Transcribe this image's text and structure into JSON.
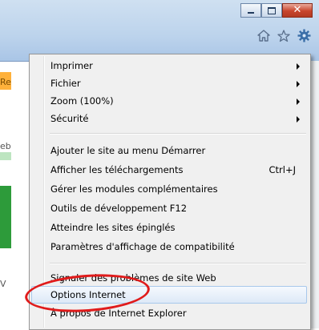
{
  "window": {
    "controls": [
      "minimize-icon",
      "maximize-icon",
      "close-icon"
    ],
    "toolbar_icons": [
      "home-icon",
      "favorites-star-icon",
      "tools-gear-icon"
    ]
  },
  "background_fragments": [
    "Re",
    "eb",
    "V"
  ],
  "menu": {
    "items": [
      {
        "label": "Imprimer",
        "submenu": true
      },
      {
        "label": "Fichier",
        "submenu": true
      },
      {
        "label": "Zoom (100%)",
        "submenu": true
      },
      {
        "label": "Sécurité",
        "submenu": true
      },
      {
        "label": "Ajouter le site au menu Démarrer"
      },
      {
        "label": "Afficher les téléchargements",
        "shortcut": "Ctrl+J"
      },
      {
        "label": "Gérer les modules complémentaires"
      },
      {
        "label": "Outils de développement F12"
      },
      {
        "label": "Atteindre les sites épinglés"
      },
      {
        "label": "Paramètres d'affichage de compatibilité"
      },
      {
        "label": "Signaler des problèmes de site Web"
      },
      {
        "label": "Options Internet",
        "highlighted": true
      },
      {
        "label": "À propos de Internet Explorer"
      }
    ]
  },
  "colors": {
    "annotation_circle": "#e01b1b",
    "highlight": "#dde9f7",
    "close_button": "#c8452c"
  }
}
